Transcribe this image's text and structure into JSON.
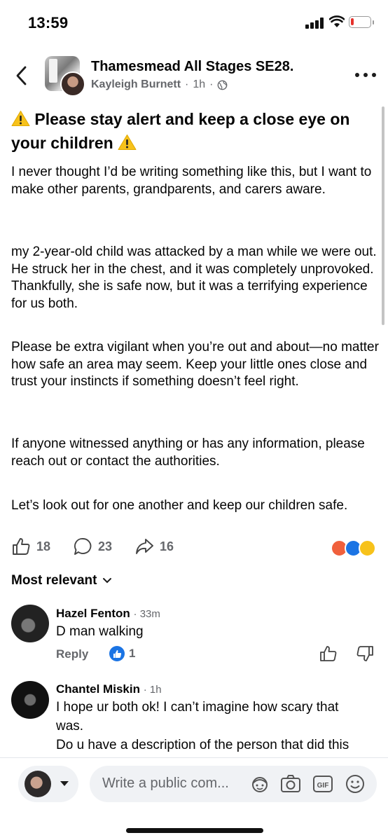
{
  "status_bar": {
    "time": "13:59"
  },
  "header": {
    "group_name": "Thamesmead All Stages SE28.",
    "author": "Kayleigh Burnett",
    "time": "1h",
    "separator": "·"
  },
  "post": {
    "title": "Please stay alert and keep a close eye on your children",
    "paragraphs": [
      "I never thought I’d be writing something like this, but I want to make other parents, grandparents, and carers aware.",
      "my 2-year-old child was attacked by a man while we were out. He struck her in the chest, and it was completely unprovoked. Thankfully, she is safe now, but it was a terrifying experience for us both.",
      "Please be extra vigilant when you’re out and about—no matter how safe an area may seem. Keep your little ones close and trust your instincts if something doesn’t feel right.",
      "If anyone witnessed anything or has any information, please reach out or contact the authorities.",
      "Let’s look out for one another and keep our children safe."
    ]
  },
  "actions": {
    "likes": "18",
    "comments": "23",
    "shares": "16"
  },
  "reactions": [
    "angry-reaction-icon",
    "like-reaction-icon",
    "wow-reaction-icon"
  ],
  "sort": {
    "label": "Most relevant"
  },
  "comments": [
    {
      "name": "Hazel Fenton",
      "time": "33m",
      "text": "D man walking",
      "reply_label": "Reply",
      "likes": "1"
    },
    {
      "name": "Chantel Miskin",
      "time": "1h",
      "text_lines": [
        "I hope ur both ok! I can’t imagine how scary that",
        "was.",
        "Do u have a description of the person that did this"
      ]
    }
  ],
  "composer": {
    "placeholder": "Write a public com..."
  },
  "colors": {
    "accent": "#1b74e4",
    "secondary_text": "#65676b",
    "input_bg": "#f0f2f5"
  }
}
